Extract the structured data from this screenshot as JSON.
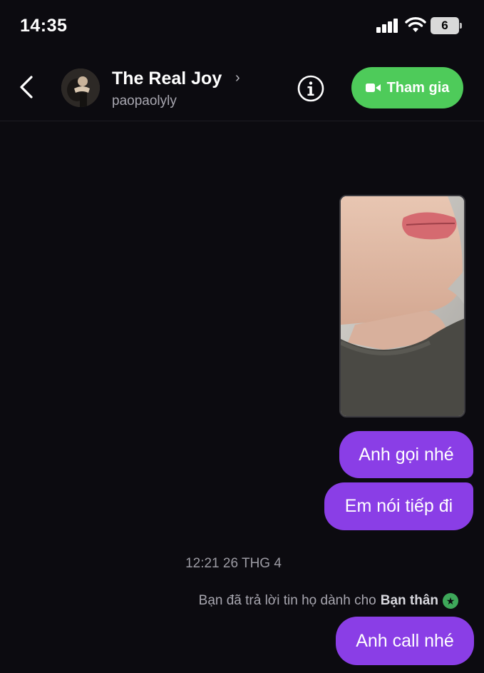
{
  "status_bar": {
    "time": "14:35",
    "battery": "6"
  },
  "header": {
    "contact_name": "The Real Joy",
    "chevron": "›",
    "handle": "paopaolyly",
    "join_label": "Tham gia",
    "join_color": "#4ecb5a",
    "icons": [
      "back-chevron-icon",
      "info-icon",
      "video-camera-icon"
    ]
  },
  "messages": [
    {
      "type": "photo",
      "description_icon": "photo-thumbnail"
    },
    {
      "type": "text",
      "text": "Anh gọi nhé"
    },
    {
      "type": "text",
      "text": "Em nói tiếp đi"
    }
  ],
  "timestamp": "12:21 26 THG 4",
  "reply_note": {
    "prefix": "Bạn đã trả lời tin họ dành cho",
    "highlight": "Bạn thân",
    "badge_glyph": "★"
  },
  "last_message": "Anh call nhé",
  "colors": {
    "bubble": "#8a3ee6",
    "background": "#0c0b10",
    "close_friends": "#3ea85a"
  }
}
